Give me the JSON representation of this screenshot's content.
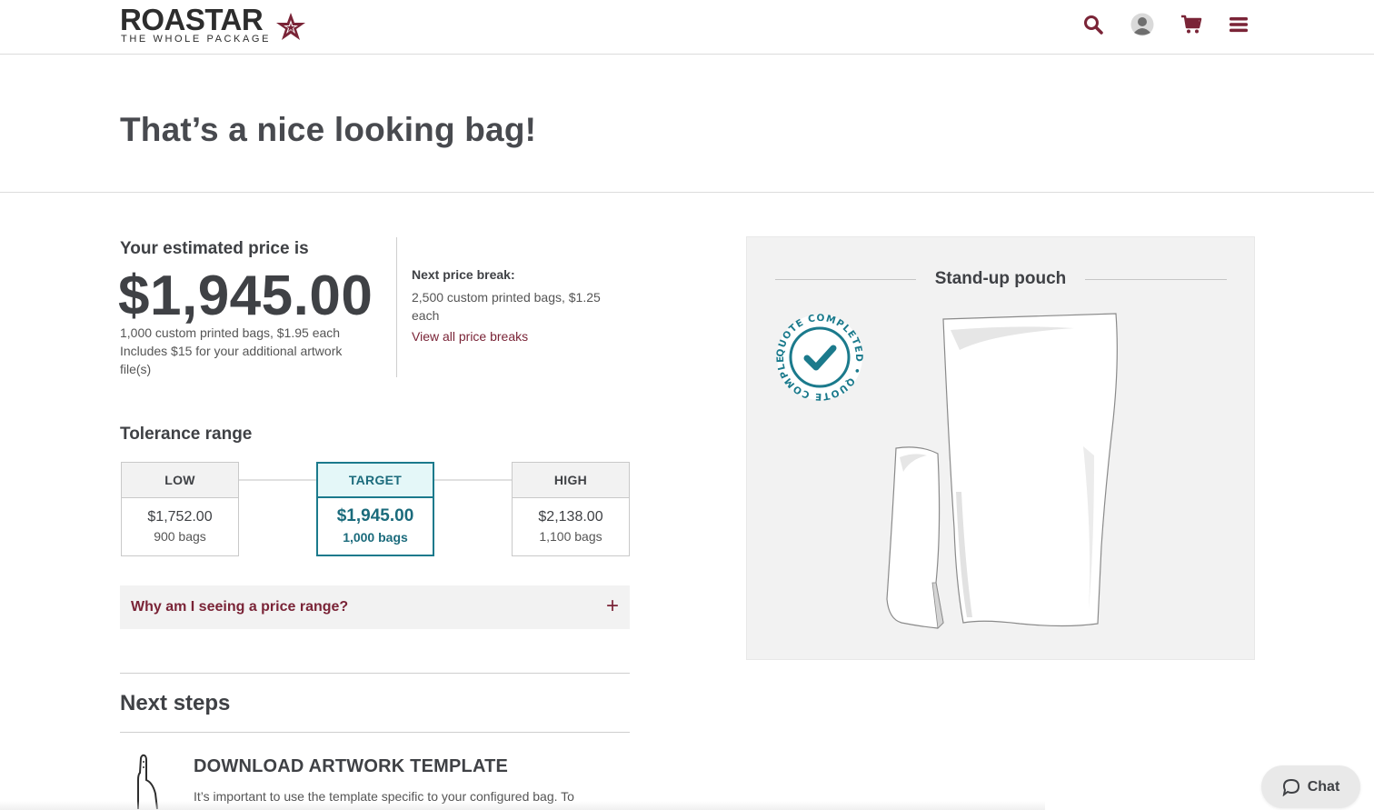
{
  "header": {
    "logo_word": "ROASTAR",
    "logo_tagline": "THE WHOLE PACKAGE",
    "icons": [
      "search-icon",
      "user-avatar-icon",
      "cart-icon",
      "menu-icon"
    ]
  },
  "hero": {
    "title": "That’s a nice looking bag!"
  },
  "price": {
    "label": "Your estimated price is",
    "amount": "$1,945.00",
    "line1": "1,000 custom printed bags, $1.95 each",
    "line2": "Includes $15 for your additional artwork",
    "line3": "file(s)"
  },
  "next_price_break": {
    "label": "Next price break:",
    "text": "2,500 custom printed bags, $1.25 each",
    "link": "View all price breaks"
  },
  "tolerance": {
    "title": "Tolerance range",
    "options": [
      {
        "label": "LOW",
        "price": "$1,752.00",
        "bags": "900 bags"
      },
      {
        "label": "TARGET",
        "price": "$1,945.00",
        "bags": "1,000 bags"
      },
      {
        "label": "HIGH",
        "price": "$2,138.00",
        "bags": "1,100 bags"
      }
    ],
    "selected": "TARGET"
  },
  "faq": {
    "question": "Why am I seeing a price range?",
    "toggle": "+"
  },
  "next_steps": {
    "title": "Next steps",
    "step_title": "DOWNLOAD ARTWORK TEMPLATE",
    "step_text": "It’s important to use the template specific to your configured bag. To"
  },
  "preview": {
    "title": "Stand-up pouch",
    "stamp_text": "QUOTE COMPLETED • QUOTE COMPLETED •"
  },
  "chat": {
    "label": "Chat"
  },
  "colors": {
    "brand_maroon": "#7a2437",
    "teal": "#1b7a8c",
    "text_dark": "#3f4145",
    "panel_bg": "#f2f2f2"
  }
}
